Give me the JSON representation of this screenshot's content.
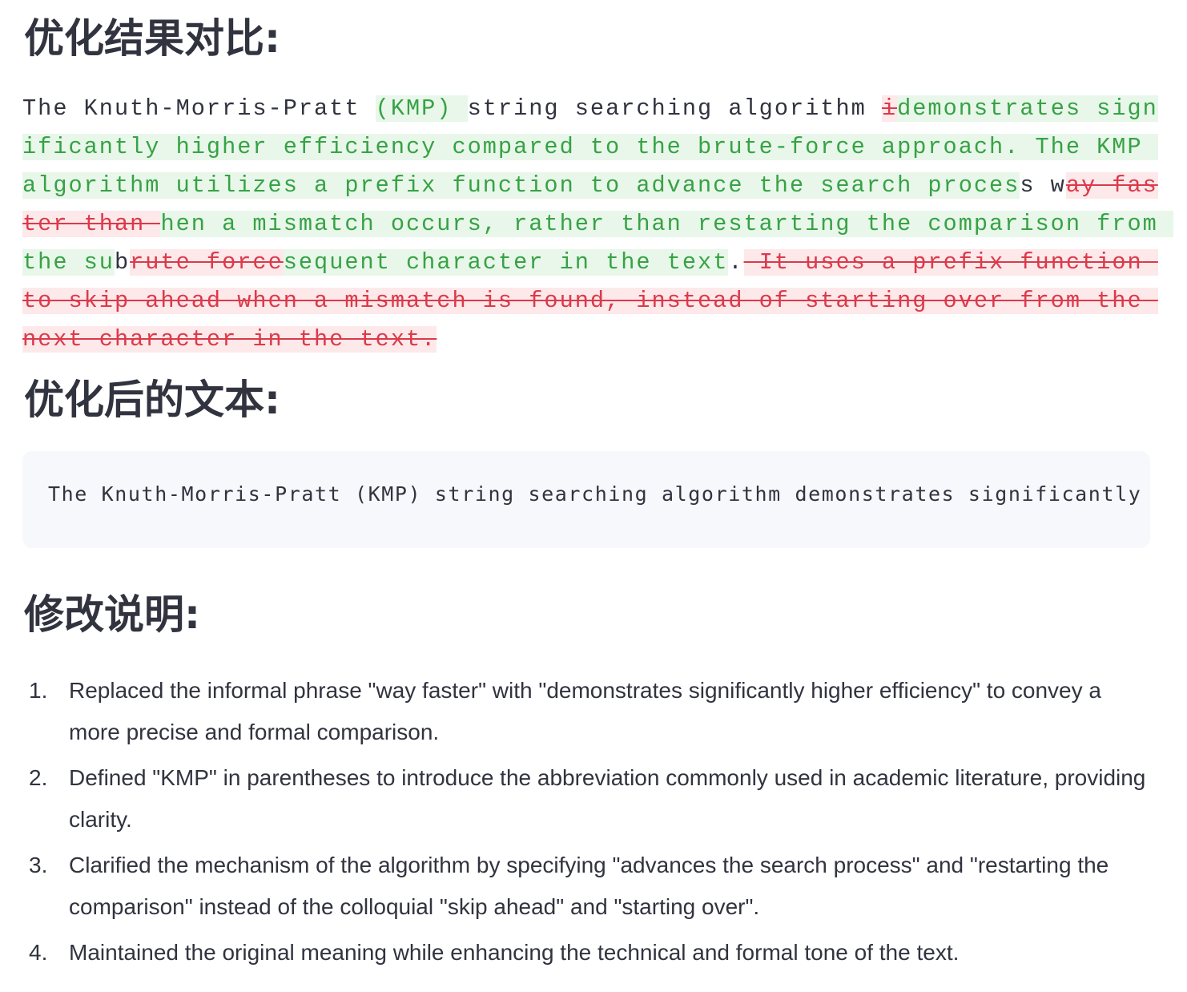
{
  "headings": {
    "comparison": "优化结果对比:",
    "optimized_text": "优化后的文本:",
    "explanation": "修改说明:"
  },
  "diff_segments": [
    {
      "type": "same",
      "text": "The Knuth-Morris-Pratt "
    },
    {
      "type": "ins",
      "text": "(KMP) "
    },
    {
      "type": "same",
      "text": "string searching algorithm "
    },
    {
      "type": "del",
      "text": "i"
    },
    {
      "type": "ins",
      "text": "demonstrates significantly higher efficiency compared to the brute-force approach. The KMP algorithm utilizes a prefix function to advance the search proces"
    },
    {
      "type": "same",
      "text": "s w"
    },
    {
      "type": "del",
      "text": "ay faster than "
    },
    {
      "type": "ins",
      "text": "hen a mismatch occurs, rather than restarting the comparison from the su"
    },
    {
      "type": "same",
      "text": "b"
    },
    {
      "type": "del",
      "text": "rute force"
    },
    {
      "type": "ins",
      "text": "sequent character in the text"
    },
    {
      "type": "same",
      "text": "."
    },
    {
      "type": "del",
      "text": " It uses a prefix function to skip ahead when a mismatch is found, instead of starting over from the next character in the text."
    }
  ],
  "optimized_code": "The Knuth-Morris-Pratt (KMP) string searching algorithm demonstrates significantly",
  "notes": [
    {
      "num": "1.",
      "text": "Replaced the informal phrase \"way faster\" with \"demonstrates significantly higher efficiency\" to convey a more precise and formal comparison."
    },
    {
      "num": "2.",
      "text": "Defined \"KMP\" in parentheses to introduce the abbreviation commonly used in academic literature, providing clarity."
    },
    {
      "num": "3.",
      "text": "Clarified the mechanism of the algorithm by specifying \"advances the search process\" and \"restarting the comparison\" instead of the colloquial \"skip ahead\" and \"starting over\"."
    },
    {
      "num": "4.",
      "text": "Maintained the original meaning while enhancing the technical and formal tone of the text."
    }
  ],
  "colors": {
    "insert_bg": "#e8f7ea",
    "insert_text": "#37a245",
    "delete_bg": "#fde8ea",
    "delete_text": "#db3a4a"
  }
}
